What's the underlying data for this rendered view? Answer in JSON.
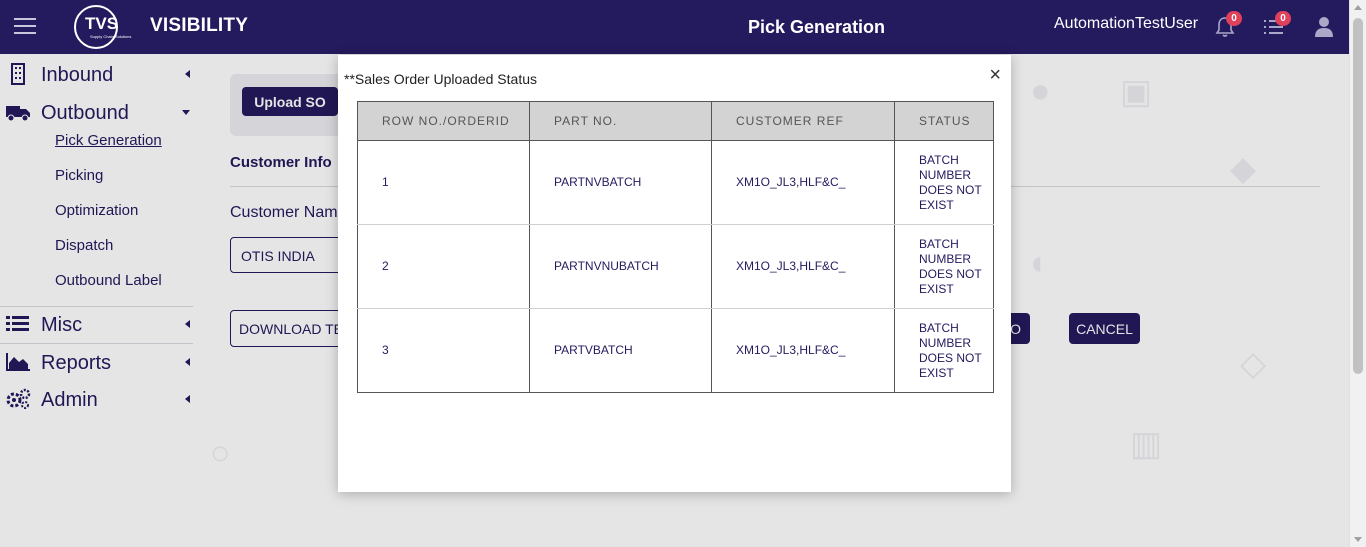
{
  "header": {
    "brand": "VISIBILITY",
    "logo_text": "TVS",
    "logo_subtext": "Supply Chain Solutions",
    "page_title": "Pick Generation",
    "username": "AutomationTestUser",
    "notifications_count": "0",
    "tasks_count": "0"
  },
  "sidebar": {
    "inbound": "Inbound",
    "outbound": "Outbound",
    "outbound_items": [
      "Pick Generation",
      "Picking",
      "Optimization",
      "Dispatch",
      "Outbound Label"
    ],
    "misc": "Misc",
    "reports": "Reports",
    "admin": "Admin"
  },
  "main": {
    "upload_so": "Upload SO",
    "customer_info": "Customer Info",
    "customer_name_label": "Customer Nam",
    "customer_name_value": "OTIS INDIA",
    "download_template": "DOWNLOAD TE",
    "partial_button": "O",
    "cancel": "CANCEL"
  },
  "modal": {
    "title": "**Sales Order Uploaded Status",
    "close": "×",
    "columns": [
      "ROW NO./ORDERID",
      "PART NO.",
      "CUSTOMER REF",
      "STATUS"
    ],
    "rows": [
      {
        "row": "1",
        "part": "PARTNVBATCH",
        "ref": "XM1O_JL3,HLF&C_",
        "status": "BATCH NUMBER DOES NOT EXIST"
      },
      {
        "row": "2",
        "part": "PARTNVNUBATCH",
        "ref": "XM1O_JL3,HLF&C_",
        "status": "BATCH NUMBER DOES NOT EXIST"
      },
      {
        "row": "3",
        "part": "PARTVBATCH",
        "ref": "XM1O_JL3,HLF&C_",
        "status": "BATCH NUMBER DOES NOT EXIST"
      }
    ]
  },
  "colors": {
    "primary": "#241a5e",
    "badge": "#e0405a"
  }
}
